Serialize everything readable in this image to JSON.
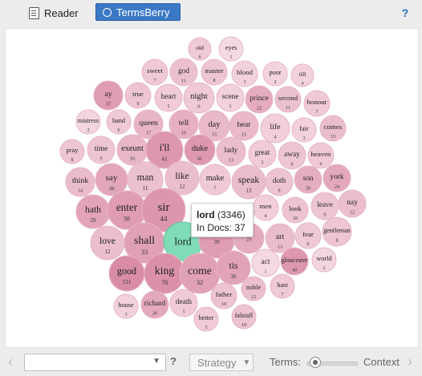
{
  "toolbar": {
    "reader_label": "Reader",
    "termsberry_label": "TermsBerry",
    "help_label": "?"
  },
  "colors": {
    "active_tab": "#3b79c7",
    "selected_bubble": "#7fdcb6",
    "bubble_light": "#f6dde4",
    "bubble_dark": "#d98ca5"
  },
  "bubbles": [
    {
      "term": "old",
      "count": "6",
      "shade": 0.25
    },
    {
      "term": "eyes",
      "count": "1",
      "shade": 0.05
    },
    {
      "term": "sweet",
      "count": "7",
      "shade": 0.25
    },
    {
      "term": "god",
      "count": "11",
      "shade": 0.35
    },
    {
      "term": "master",
      "count": "8",
      "shade": 0.3
    },
    {
      "term": "blood",
      "count": "3",
      "shade": 0.15
    },
    {
      "term": "poor",
      "count": "2",
      "shade": 0.12
    },
    {
      "term": "till",
      "count": "4",
      "shade": 0.15
    },
    {
      "term": "ay",
      "count": "37",
      "shade": 0.8
    },
    {
      "term": "true",
      "count": "9",
      "shade": 0.3
    },
    {
      "term": "heart",
      "count": "5",
      "shade": 0.22
    },
    {
      "term": "night",
      "count": "6",
      "shade": 0.25
    },
    {
      "term": "scene",
      "count": "3",
      "shade": 0.15
    },
    {
      "term": "prince",
      "count": "22",
      "shade": 0.6
    },
    {
      "term": "second",
      "count": "11",
      "shade": 0.35
    },
    {
      "term": "honour",
      "count": "7",
      "shade": 0.25
    },
    {
      "term": "mistress",
      "count": "2",
      "shade": 0.1
    },
    {
      "term": "hand",
      "count": "6",
      "shade": 0.25
    },
    {
      "term": "queen",
      "count": "17",
      "shade": 0.5
    },
    {
      "term": "tell",
      "count": "19",
      "shade": 0.55
    },
    {
      "term": "day",
      "count": "15",
      "shade": 0.45
    },
    {
      "term": "hear",
      "count": "15",
      "shade": 0.45
    },
    {
      "term": "life",
      "count": "4",
      "shade": 0.18
    },
    {
      "term": "fair",
      "count": "3",
      "shade": 0.15
    },
    {
      "term": "comes",
      "count": "13",
      "shade": 0.4
    },
    {
      "term": "pray",
      "count": "8",
      "shade": 0.28
    },
    {
      "term": "time",
      "count": "9",
      "shade": 0.3
    },
    {
      "term": "exeunt",
      "count": "16",
      "shade": 0.48
    },
    {
      "term": "i'll",
      "count": "41",
      "shade": 0.85
    },
    {
      "term": "duke",
      "count": "41",
      "shade": 0.85
    },
    {
      "term": "lady",
      "count": "13",
      "shade": 0.4
    },
    {
      "term": "great",
      "count": "5",
      "shade": 0.22
    },
    {
      "term": "away",
      "count": "9",
      "shade": 0.3
    },
    {
      "term": "heaven",
      "count": "6",
      "shade": 0.25
    },
    {
      "term": "think",
      "count": "14",
      "shade": 0.42
    },
    {
      "term": "say",
      "count": "28",
      "shade": 0.68
    },
    {
      "term": "man",
      "count": "11",
      "shade": 0.35
    },
    {
      "term": "like",
      "count": "12",
      "shade": 0.38
    },
    {
      "term": "make",
      "count": "7",
      "shade": 0.25
    },
    {
      "term": "speak",
      "count": "13",
      "shade": 0.4
    },
    {
      "term": "doth",
      "count": "9",
      "shade": 0.3
    },
    {
      "term": "son",
      "count": "20",
      "shade": 0.58
    },
    {
      "term": "york",
      "count": "24",
      "shade": 0.65
    },
    {
      "term": "hath",
      "count": "29",
      "shade": 0.7
    },
    {
      "term": "enter",
      "count": "38",
      "shade": 0.8
    },
    {
      "term": "sir",
      "count": "44",
      "shade": 0.88
    },
    {
      "term": "men",
      "count": "4",
      "shade": 0.18
    },
    {
      "term": "look",
      "count": "10",
      "shade": 0.32
    },
    {
      "term": "leave",
      "count": "9",
      "shade": 0.3
    },
    {
      "term": "nay",
      "count": "12",
      "shade": 0.38
    },
    {
      "term": "love",
      "count": "12",
      "shade": 0.38
    },
    {
      "term": "shall",
      "count": "33",
      "shade": 0.75
    },
    {
      "term": "lord",
      "count": "",
      "shade": 0
    },
    {
      "term": "",
      "count": "39",
      "shade": 0.8
    },
    {
      "term": "",
      "count": "23",
      "shade": 0.62
    },
    {
      "term": "art",
      "count": "13",
      "shade": 0.4
    },
    {
      "term": "fear",
      "count": "6",
      "shade": 0.25
    },
    {
      "term": "gentleman",
      "count": "8",
      "shade": 0.28
    },
    {
      "term": "good",
      "count": "121",
      "shade": 1.0
    },
    {
      "term": "king",
      "count": "78",
      "shade": 0.95
    },
    {
      "term": "come",
      "count": "32",
      "shade": 0.74
    },
    {
      "term": "tis",
      "count": "30",
      "shade": 0.72
    },
    {
      "term": "act",
      "count": "1",
      "shade": 0.05
    },
    {
      "term": "gloucester",
      "count": "40",
      "shade": 0.85
    },
    {
      "term": "world",
      "count": "2",
      "shade": 0.1
    },
    {
      "term": "noble",
      "count": "12",
      "shade": 0.38
    },
    {
      "term": "hast",
      "count": "7",
      "shade": 0.25
    },
    {
      "term": "house",
      "count": "3",
      "shade": 0.15
    },
    {
      "term": "richard",
      "count": "26",
      "shade": 0.66
    },
    {
      "term": "death",
      "count": "5",
      "shade": 0.22
    },
    {
      "term": "father",
      "count": "10",
      "shade": 0.32
    },
    {
      "term": "better",
      "count": "5",
      "shade": 0.22
    },
    {
      "term": "falstaff",
      "count": "10",
      "shade": 0.32
    }
  ],
  "tooltip": {
    "term": "lord",
    "freq": "(3346)",
    "docs": "In Docs: 37"
  },
  "bottom": {
    "prev_label": "‹",
    "next_label": "›",
    "search_value": "",
    "help_label": "?",
    "strategy_label": "Strategy",
    "terms_label": "Terms:",
    "context_label": "Context",
    "slider_value": 0.15
  }
}
